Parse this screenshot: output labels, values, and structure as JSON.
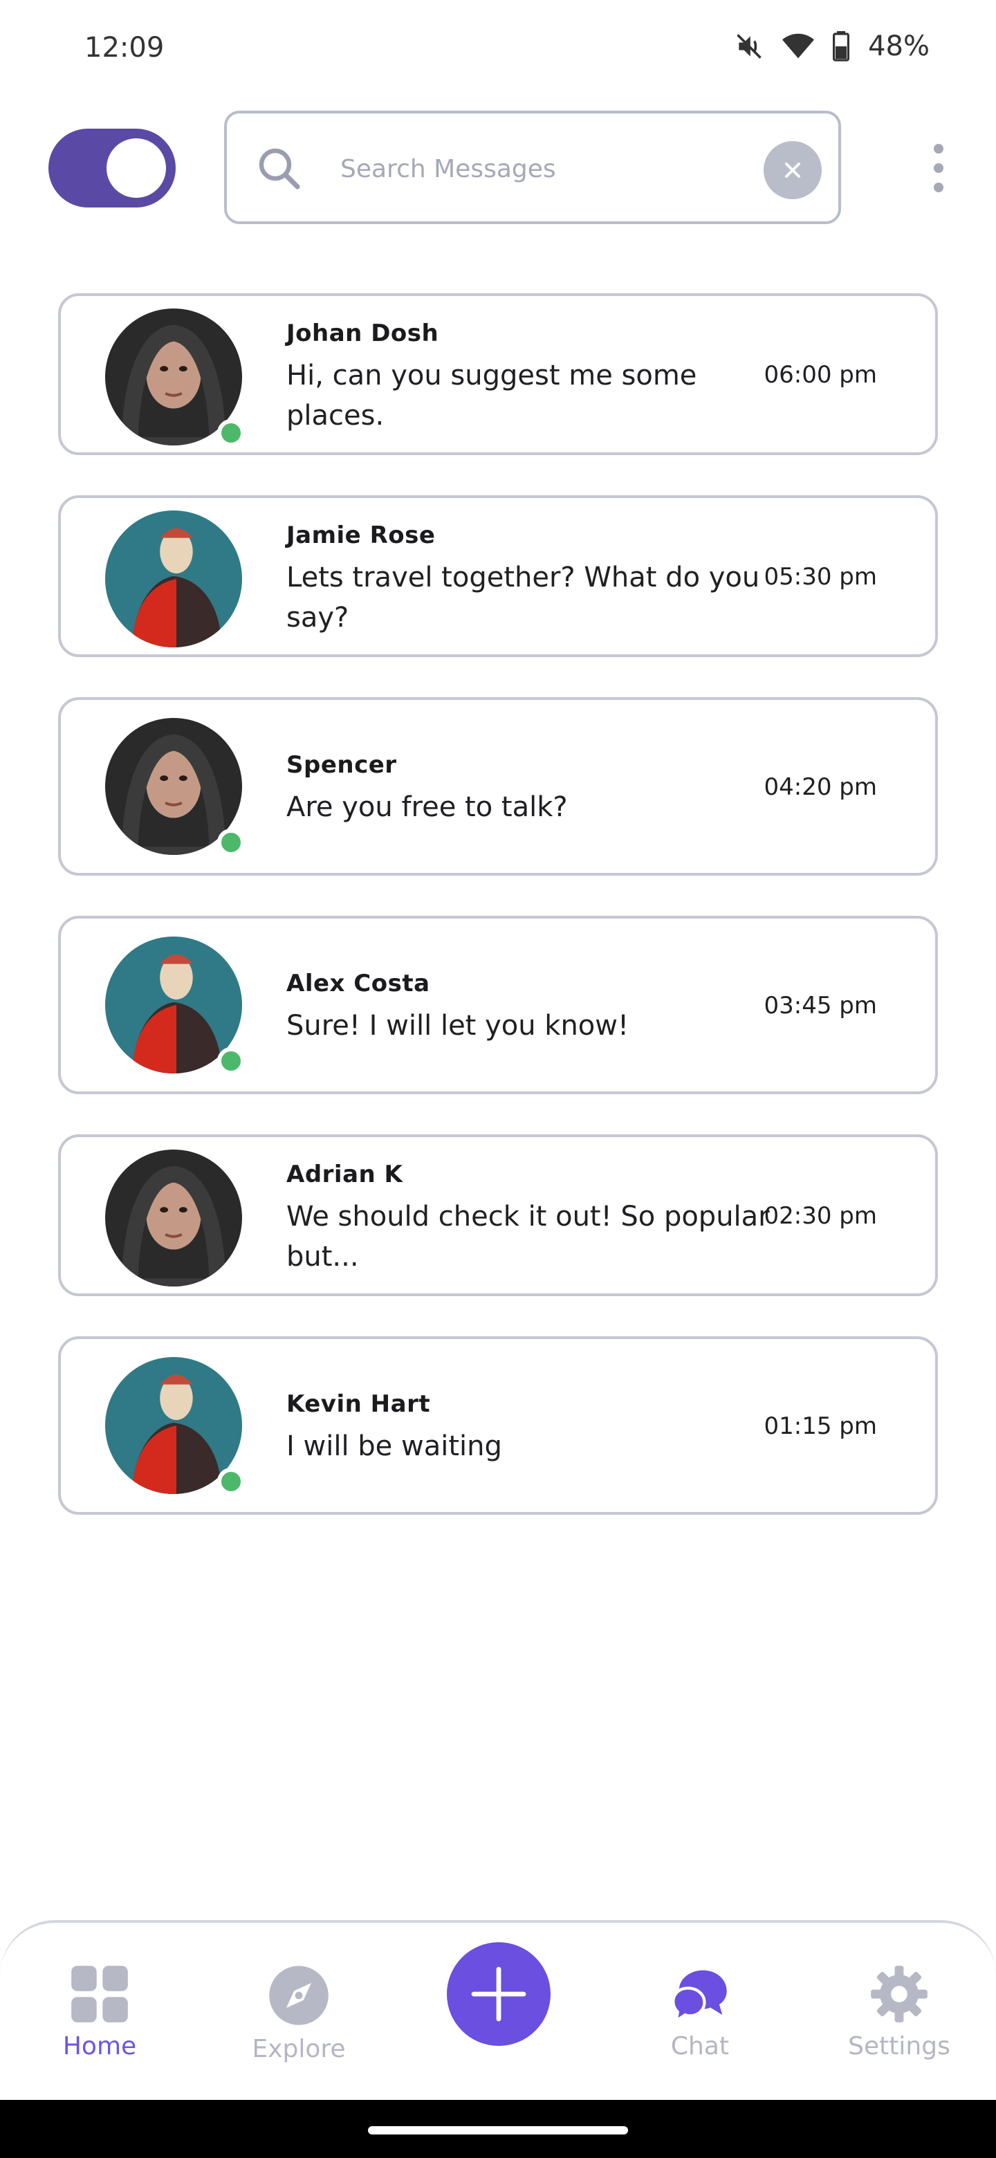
{
  "status_bar": {
    "time": "12:09",
    "battery": "48%",
    "icons": [
      "mute-icon",
      "wifi-icon",
      "battery-icon"
    ]
  },
  "top_bar": {
    "search_placeholder": "Search Messages",
    "toggle_on": true,
    "accent_color": "#5a4aa6"
  },
  "chats": [
    {
      "name": "Johan Dosh",
      "message": "Hi, can you suggest me some places.",
      "time": "06:00 pm",
      "online": true
    },
    {
      "name": "Jamie Rose",
      "message": "Lets travel together? What do you say?",
      "time": "05:30 pm",
      "online": false
    },
    {
      "name": "Spencer",
      "message": "Are you free to talk?",
      "time": "04:20 pm",
      "online": true
    },
    {
      "name": "Alex Costa",
      "message": "Sure! I will let you know!",
      "time": "03:45 pm",
      "online": true
    },
    {
      "name": "Adrian K",
      "message": "We should check it out! So popular but...",
      "time": "02:30 pm",
      "online": false
    },
    {
      "name": "Kevin Hart",
      "message": "I will be waiting",
      "time": "01:15 pm",
      "online": true
    }
  ],
  "bottom_nav": {
    "items": [
      {
        "label": "Home",
        "icon": "grid-icon",
        "active": true
      },
      {
        "label": "Explore",
        "icon": "compass-icon",
        "active": false
      },
      {
        "label": "Chat",
        "icon": "chat-bubble-icon",
        "active": false
      },
      {
        "label": "Settings",
        "icon": "gear-icon",
        "active": false
      }
    ],
    "fab_icon": "plus-icon",
    "active_color": "#6e55e0",
    "inactive_color": "#b4b6c4"
  }
}
